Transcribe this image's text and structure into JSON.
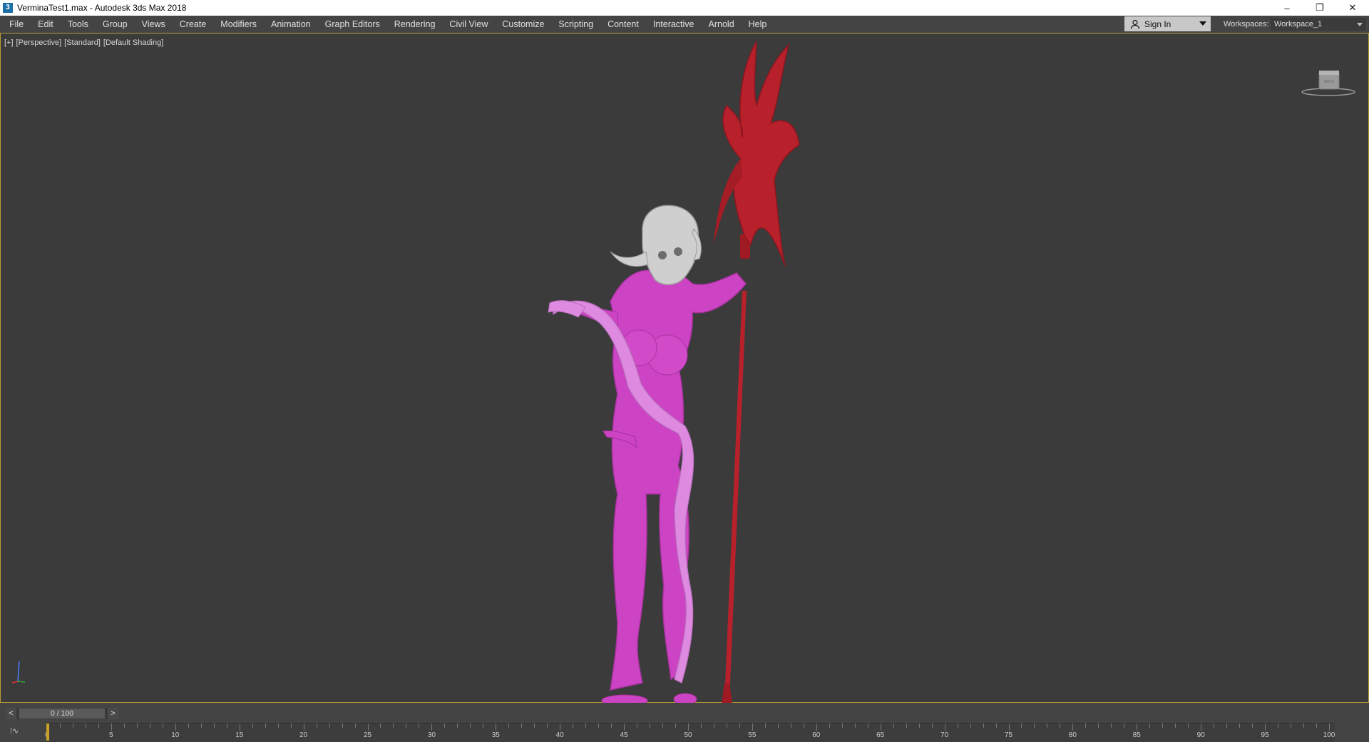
{
  "titlebar": {
    "icon": "3",
    "title": "VerminaTest1.max - Autodesk 3ds Max 2018",
    "minimize": "–",
    "restore": "❐",
    "close": "✕"
  },
  "menubar": {
    "items": [
      "File",
      "Edit",
      "Tools",
      "Group",
      "Views",
      "Create",
      "Modifiers",
      "Animation",
      "Graph Editors",
      "Rendering",
      "Civil View",
      "Customize",
      "Scripting",
      "Content",
      "Interactive",
      "Arnold",
      "Help"
    ]
  },
  "signin": {
    "label": "Sign In"
  },
  "workspaces": {
    "label": "Workspaces:",
    "value": "Workspace_1"
  },
  "viewport": {
    "label_parts": [
      "[+]",
      "[Perspective]",
      "[Standard]",
      "[Default Shading]"
    ],
    "viewcube_face": "BACK"
  },
  "colors": {
    "body": "#cc44c4",
    "skull": "#cfcfcf",
    "spear": "#b8212b",
    "tail": "#dd8ae0",
    "frame_accent": "#c9a227"
  },
  "timeline": {
    "prev": "<",
    "next": ">",
    "frame_display": "0 / 100",
    "current_frame": 0,
    "start": 0,
    "end": 100,
    "tick_labels": [
      "0",
      "5",
      "10",
      "15",
      "20",
      "25",
      "30",
      "35",
      "40",
      "45",
      "50",
      "55",
      "60",
      "65",
      "70",
      "75",
      "80",
      "85",
      "90",
      "95",
      "100"
    ],
    "toggle": "⁞∿"
  }
}
